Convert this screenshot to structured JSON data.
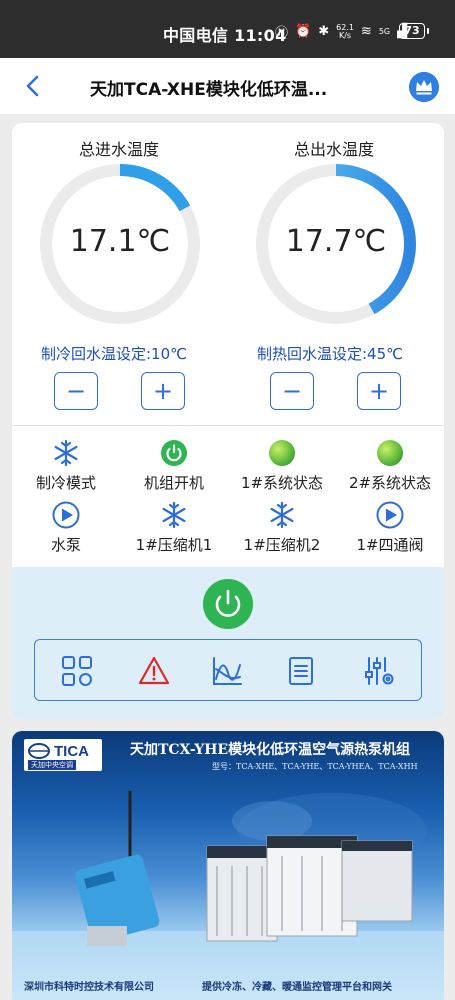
{
  "status_bar": {
    "carrier_time": "中国电信 11:04",
    "net_speed_top": "62.1",
    "net_speed_bottom": "K/s",
    "signal": "5G",
    "battery": "73"
  },
  "header": {
    "title": "天加TCA-XHE模块化低环温..."
  },
  "gauges": [
    {
      "title": "总进水温度",
      "value": "17.1℃",
      "fill_fraction": 0.17
    },
    {
      "title": "总出水温度",
      "value": "17.7℃",
      "fill_fraction": 0.42
    }
  ],
  "setpoints": {
    "cooling": "制冷回水温设定:10℃",
    "heating": "制热回水温设定:45℃"
  },
  "stepper": {
    "minus": "−",
    "plus": "+"
  },
  "status_items": [
    {
      "label": "制冷模式",
      "icon": "snowflake-icon"
    },
    {
      "label": "机组开机",
      "icon": "power-green-icon"
    },
    {
      "label": "1#系统状态",
      "icon": "green-dot-icon"
    },
    {
      "label": "2#系统状态",
      "icon": "green-dot-icon"
    },
    {
      "label": "水泵",
      "icon": "play-icon"
    },
    {
      "label": "1#压缩机1",
      "icon": "snowflake-icon"
    },
    {
      "label": "1#压缩机2",
      "icon": "snowflake-icon"
    },
    {
      "label": "1#四通阀",
      "icon": "play-icon"
    }
  ],
  "toolbar": [
    {
      "icon": "grid-apps-icon"
    },
    {
      "icon": "alarm-warning-icon"
    },
    {
      "icon": "trend-chart-icon"
    },
    {
      "icon": "list-document-icon"
    },
    {
      "icon": "settings-sliders-icon"
    }
  ],
  "banner": {
    "logo": "TICA",
    "logo_sub": "天加中央空调",
    "title": "天加TCX-YHE模块化低环温空气源热泵机组",
    "models": "型号：TCA-XHE、TCA-YHE、TCA-YHEA、TCA-XHH",
    "footer_left": "深圳市科特时控技术有限公司",
    "footer_right": "提供冷冻、冷藏、暖通监控管理平台和网关"
  },
  "colors": {
    "accent_blue": "#2e6ed8",
    "gauge_blue": "#2fa0e8",
    "green": "#2eb452",
    "setpoint_text": "#1a4fc4"
  }
}
